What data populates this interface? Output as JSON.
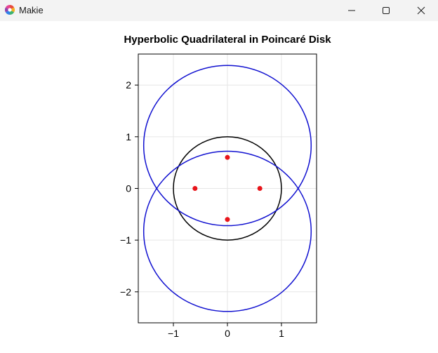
{
  "window": {
    "title": "Makie",
    "icon": "makie-logo-icon",
    "controls": [
      "minimize-icon",
      "maximize-icon",
      "close-icon"
    ]
  },
  "chart_data": {
    "type": "scatter",
    "title": "Hyperbolic Quadrilateral in Poincaré Disk",
    "xlabel": "",
    "ylabel": "",
    "xlim": [
      -1.65,
      1.65
    ],
    "ylim": [
      -2.6,
      2.6
    ],
    "xticks": [
      -1,
      0,
      1
    ],
    "xtick_labels": [
      "−1",
      "0",
      "1"
    ],
    "yticks": [
      -2,
      -1,
      0,
      1,
      2
    ],
    "ytick_labels": [
      "−2",
      "−1",
      "0",
      "1",
      "2"
    ],
    "grid": true,
    "legend": false,
    "circles": [
      {
        "role": "unit-disk",
        "cx": 0,
        "cy": 0,
        "r": 1.0,
        "color": "#000000"
      },
      {
        "role": "geodesic",
        "cx": 0,
        "cy": 0.83,
        "r": 1.55,
        "color": "#1010d0"
      },
      {
        "role": "geodesic",
        "cx": 0,
        "cy": -0.83,
        "r": 1.55,
        "color": "#1010d0"
      }
    ],
    "points": {
      "color": "#e8141a",
      "x": [
        0,
        -0.6,
        0.6,
        0
      ],
      "y": [
        0.6,
        0,
        0,
        -0.6
      ]
    }
  }
}
